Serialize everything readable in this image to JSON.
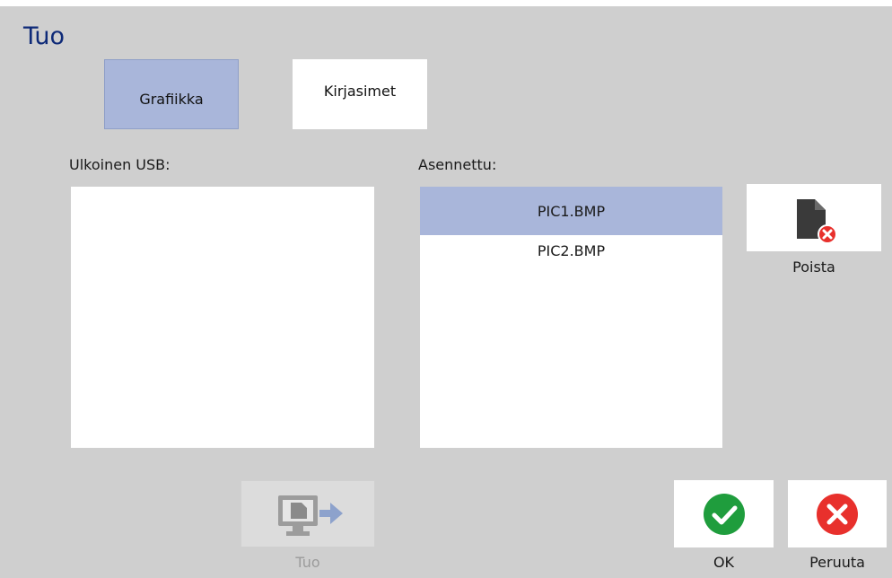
{
  "dialog": {
    "title": "Tuo"
  },
  "tabs": [
    {
      "label": "Grafiikka",
      "selected": true
    },
    {
      "label": "Kirjasimet",
      "selected": false
    }
  ],
  "usb": {
    "label": "Ulkoinen USB:",
    "items": []
  },
  "installed": {
    "label": "Asennettu:",
    "items": [
      {
        "name": "PIC1.BMP",
        "selected": true
      },
      {
        "name": "PIC2.BMP",
        "selected": false
      }
    ]
  },
  "actions": {
    "delete_label": "Poista",
    "import_label": "Tuo",
    "ok_label": "OK",
    "cancel_label": "Peruuta"
  },
  "icons": {
    "delete": "delete-file-icon",
    "import": "import-to-printer-icon",
    "ok": "green-check-icon",
    "cancel": "red-x-icon"
  },
  "colors": {
    "title": "#0e2a78",
    "dialog_bg": "#cfcfcf",
    "selected_bg": "#a9b6da",
    "ok_green": "#1f9d3d",
    "cancel_red": "#e8302c"
  }
}
